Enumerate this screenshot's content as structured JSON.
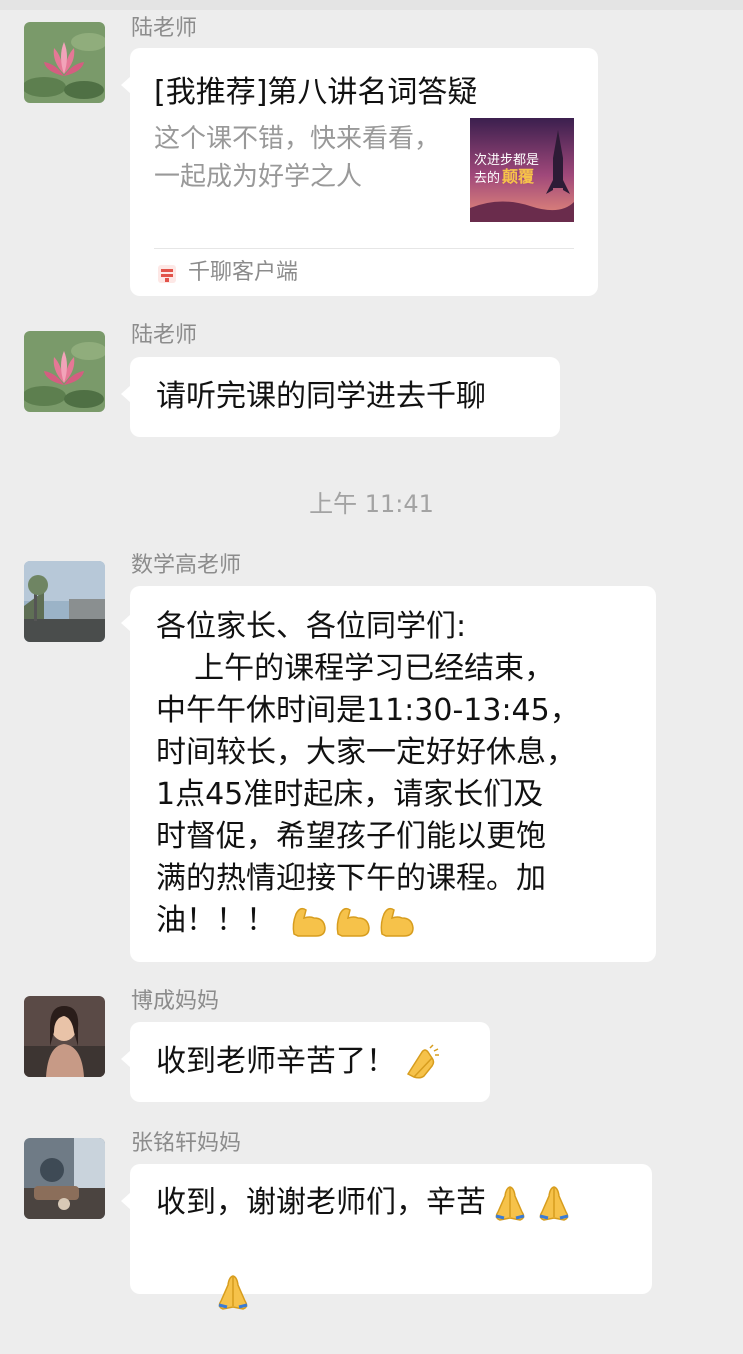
{
  "chat": {
    "timestamp": "上午 11:41",
    "messages": [
      {
        "sender": "陆老师",
        "type": "link",
        "title": "[我推荐]第八讲名词答疑",
        "description": "这个课不错，快来看看，一起成为好学之人",
        "thumb_line1": "次进步都是",
        "thumb_line2": "去的",
        "thumb_highlight": "颠覆",
        "source": "千聊客户端"
      },
      {
        "sender": "陆老师",
        "type": "text",
        "text": "请听完课的同学进去千聊"
      },
      {
        "sender": "数学高老师",
        "type": "text",
        "lines": [
          "各位家长、各位同学们:",
          "    上午的课程学习已经结束，",
          "中午午休时间是11:30-13:45，",
          "时间较长，大家一定好好休息，",
          "1点45准时起床，请家长们及",
          "时督促，希望孩子们能以更饱",
          "满的热情迎接下午的课程。加",
          "油！！！"
        ],
        "emoji": "flexed-biceps x3"
      },
      {
        "sender": "博成妈妈",
        "type": "text",
        "text": "收到老师辛苦了！",
        "emoji": "clapping-hands"
      },
      {
        "sender": "张铭轩妈妈",
        "type": "text",
        "line1": "收到，谢谢老师们，辛苦",
        "emoji": "folded-hands x3"
      }
    ]
  },
  "colors": {
    "background": "#ededed",
    "bubble": "#ffffff",
    "sender_text": "#8c8c8c",
    "timestamp_text": "#a3a3a3",
    "link_desc": "#999999"
  }
}
